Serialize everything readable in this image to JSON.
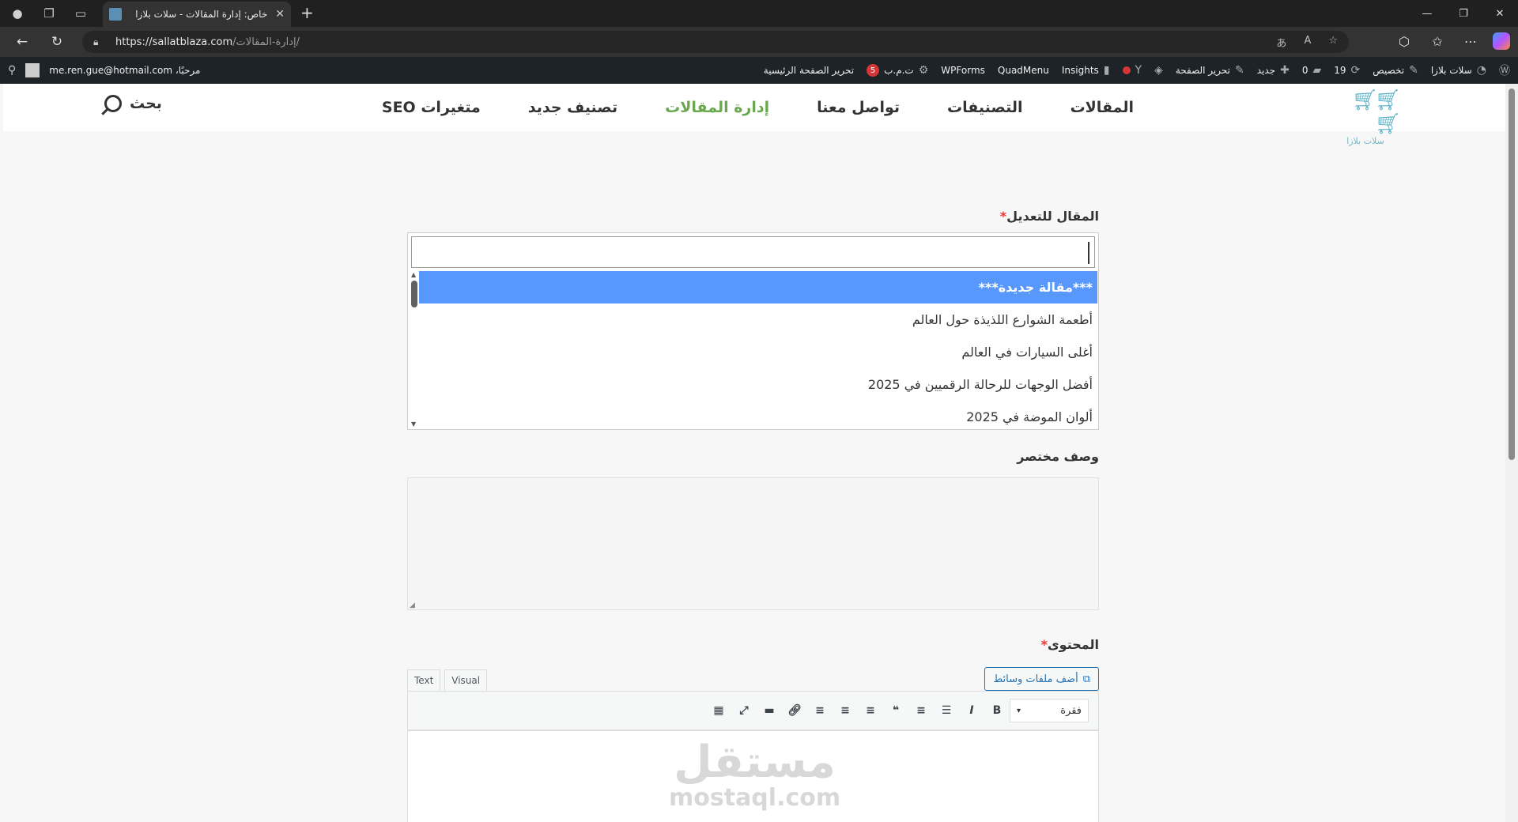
{
  "browser": {
    "tab_title": "خاص: إدارة المقالات - سلات بلازا",
    "url_host": "https://sallatblaza.com",
    "url_path": "/إدارة-المقالات/"
  },
  "adminbar": {
    "site_name": "سلات بلازا",
    "customize": "تخصيص",
    "updates_count": "19",
    "comments_count": "0",
    "new_label": "جديد",
    "edit_page": "تحرير الصفحة",
    "insights": "Insights",
    "quadmenu": "QuadMenu",
    "wpforms": "WPForms",
    "tmb_label": "ت.م.ب",
    "tmb_count": "5",
    "edit_home": "تحرير الصفحة الرئيسية",
    "greeting": "مرحبًا، me.ren.gue@hotmail.com"
  },
  "site": {
    "logo_text": "سلات بلازا",
    "menu": [
      {
        "label": "المقالات",
        "active": false
      },
      {
        "label": "التصنيفات",
        "active": false
      },
      {
        "label": "تواصل معنا",
        "active": false
      },
      {
        "label": "إدارة المقالات",
        "active": true
      },
      {
        "label": "تصنيف جديد",
        "active": false
      },
      {
        "label": "متغيرات SEO",
        "active": false
      }
    ],
    "search_label": "بحث"
  },
  "form": {
    "article_label": "المقال للتعديل",
    "required_mark": "*",
    "options": [
      "***مقالة جديدة***",
      "أطعمة الشوارع اللذيذة حول العالم",
      "أغلى السيارات في العالم",
      "أفضل الوجهات للرحالة الرقميين في 2025",
      "ألوان الموضة في 2025"
    ],
    "selected_index": 0,
    "summary_label": "وصف مختصر",
    "content_label": "المحتوى",
    "media_button": "أضف ملفات وسائط",
    "tab_visual": "Visual",
    "tab_text": "Text",
    "format_select": "فقرة"
  },
  "watermark": {
    "arabic": "مستقل",
    "latin": "mostaql.com"
  }
}
